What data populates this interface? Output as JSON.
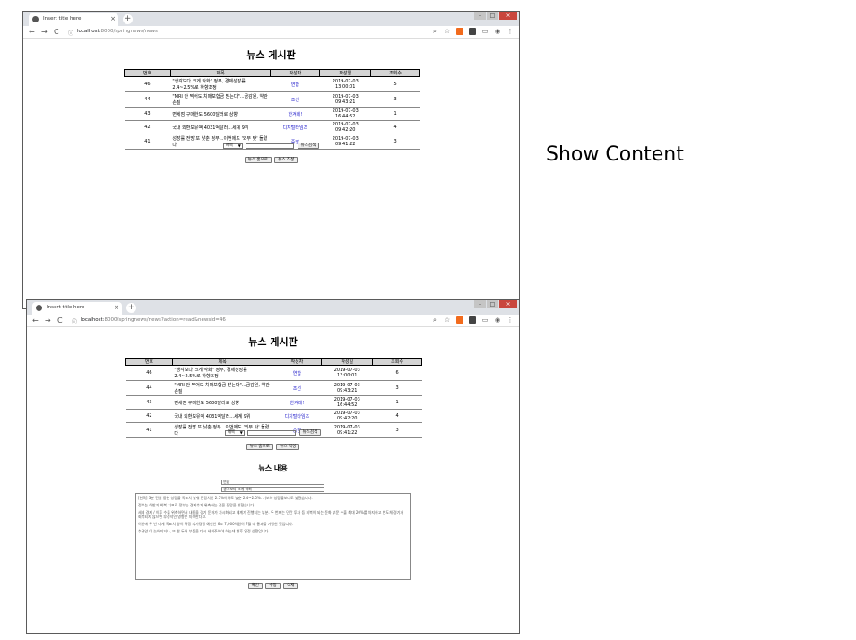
{
  "browser": {
    "tab_title": "Insert title here",
    "tab_close": "×",
    "new_tab": "+",
    "nav_back": "←",
    "nav_forward": "→",
    "nav_reload": "C",
    "url1_host": "localhost:",
    "url1_path": "8000/springnews/news",
    "url2_host": "localhost:",
    "url2_path": "8000/springnews/news?action=read&newsid=46",
    "window_min": "–",
    "window_max": "□",
    "window_close": "×"
  },
  "board": {
    "title": "뉴스 게시판",
    "headers": [
      "번호",
      "제목",
      "작성자",
      "작성일",
      "조회수"
    ],
    "rows_first": [
      {
        "id": "46",
        "title": "\"생각보다 크게 악화\" 정부, 경제성장률 2.4~2.5%로 하향조정",
        "writer": "연합",
        "date": "2019-07-03 13:00:01",
        "views": "5"
      },
      {
        "id": "44",
        "title": "\"MRI 안 찍어도 치매보험금 받는다\"...금감원, 약관 손질",
        "writer": "조선",
        "date": "2019-07-03 09:43:21",
        "views": "3"
      },
      {
        "id": "43",
        "title": "면세점 구매한도 5600달러로 상향",
        "writer": "한겨레!",
        "date": "2019-07-03 16:44:52",
        "views": "1"
      },
      {
        "id": "42",
        "title": "국내 외환보유액 4031억달러...세계 9위",
        "writer": "디지털타임즈",
        "date": "2019-07-03 09:42:20",
        "views": "4"
      },
      {
        "id": "41",
        "title": "성장률 전망 또 낮춘 정부...이번에도 '외부 탓' 돌렸다",
        "writer": "중앙",
        "date": "2019-07-03 09:41:22",
        "views": "3"
      }
    ],
    "rows_second_views": [
      "6",
      "3",
      "1",
      "4",
      "3"
    ],
    "search_select": "제목",
    "search_button": "뉴스검색",
    "list_button": "뉴스 홈으로",
    "write_button": "뉴스 작성"
  },
  "detail": {
    "subtitle": "뉴스 내용",
    "writer_value": "연합",
    "title_value": "생각보다 크게 악화",
    "content_lines": [
      "[한국] 3분 전원 중한 성장률 목표치 낮춰 전망치인 2.5%이하로 낮춘 2.4~2.5%. 기보하 성장률보다도 낮췄습니다.",
      "정부는 하반기 회복 지표로 정부는 경제추가 위축하는 것을 전망을 밝혔습니다.",
      "세계 경제 / 이후 수출 위축하면서 내용을 경기 둔화가 가시화되고 세계가 진행되는 부분. 두 번째는 민간 투자 등 회복이 되는 둔화 부문 수출 최대 20%를 차지하고 반도체 경기가 회복되지 않으면 부정적인 영향은 지속한다고.",
      "이번에 두 번 내게 목표치 향이 특징 추가경정 예산안 6조 7,000억원이 7월 내 통과를 가정한 것입니다.",
      "추경안 이 늦어지거나, 또 한 두어 부문을 다시 세워주어야 하는데 향후 일정 상황입니다."
    ],
    "confirm_button": "확인",
    "edit_button": "수정",
    "delete_button": "삭제"
  },
  "annotation": {
    "label": "Show Content"
  }
}
